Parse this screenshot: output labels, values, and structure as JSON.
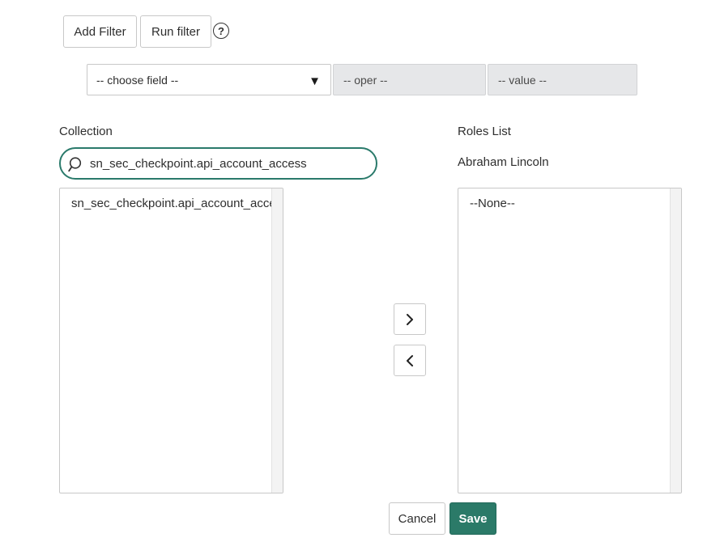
{
  "filter": {
    "add_filter_label": "Add Filter",
    "run_filter_label": "Run filter",
    "help_glyph": "?",
    "field_select": "-- choose field --",
    "field_select_arrow": "▼",
    "operator": "-- oper --",
    "value": "-- value --"
  },
  "collection": {
    "label": "Collection",
    "search_value": "sn_sec_checkpoint.api_account_access",
    "items": [
      "sn_sec_checkpoint.api_account_access"
    ]
  },
  "roles": {
    "label": "Roles List",
    "user": "Abraham Lincoln",
    "items": [
      "--None--"
    ]
  },
  "actions": {
    "add_glyph": "›",
    "remove_glyph": "‹",
    "cancel_label": "Cancel",
    "save_label": "Save"
  },
  "colors": {
    "accent": "#2b7a68",
    "search_border": "#2a7a6b",
    "disabled_bg": "#e6e7e9"
  },
  "icons": {
    "help": "question-circle-icon",
    "search": "search-icon",
    "add": "chevron-right-icon",
    "remove": "chevron-left-icon",
    "dropdown": "triangle-down-icon"
  }
}
